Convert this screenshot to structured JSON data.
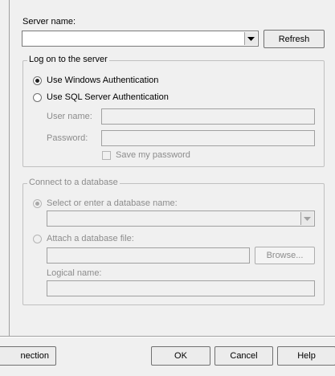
{
  "server": {
    "label": "Server name:",
    "value": "",
    "refresh_label": "Refresh"
  },
  "logon": {
    "legend": "Log on to the server",
    "windows_auth_label": "Use Windows Authentication",
    "sql_auth_label": "Use SQL Server Authentication",
    "selected": "windows",
    "user_name_label": "User name:",
    "password_label": "Password:",
    "save_password_label": "Save my password"
  },
  "database": {
    "legend": "Connect to a database",
    "select_db_label": "Select or enter a database name:",
    "attach_file_label": "Attach a database file:",
    "browse_label": "Browse...",
    "logical_name_label": "Logical name:"
  },
  "footer": {
    "test_connection_partial": "nection",
    "ok_label": "OK",
    "cancel_label": "Cancel",
    "help_label": "Help"
  }
}
